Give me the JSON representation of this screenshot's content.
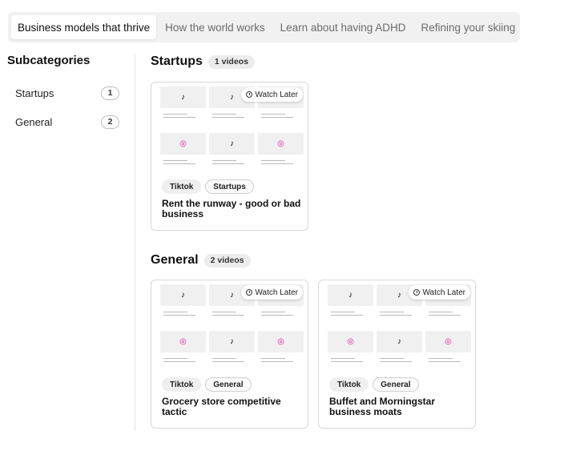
{
  "tabs": [
    {
      "label": "Business models that thrive",
      "active": true
    },
    {
      "label": "How the world works",
      "active": false
    },
    {
      "label": "Learn about having ADHD",
      "active": false
    },
    {
      "label": "Refining your skiing",
      "active": false
    }
  ],
  "sidebar": {
    "title": "Subcategories",
    "items": [
      {
        "label": "Startups",
        "count": "1"
      },
      {
        "label": "General",
        "count": "2"
      }
    ]
  },
  "sections": [
    {
      "title": "Startups",
      "badge": "1 videos",
      "cards": [
        {
          "watch_later": "Watch Later",
          "tags": [
            "Tiktok",
            "Startups"
          ],
          "title": "Rent the runway - good or bad business"
        }
      ]
    },
    {
      "title": "General",
      "badge": "2 videos",
      "cards": [
        {
          "watch_later": "Watch Later",
          "tags": [
            "Tiktok",
            "General"
          ],
          "title": "Grocery store competitive tactic"
        },
        {
          "watch_later": "Watch Later",
          "tags": [
            "Tiktok",
            "General"
          ],
          "title": "Buffet and Morningstar business moats"
        }
      ]
    }
  ],
  "thumbnail_icons": [
    "tiktok-icon",
    "tiktok-icon",
    "blank",
    "instagram-icon",
    "tiktok-icon",
    "instagram-icon"
  ]
}
